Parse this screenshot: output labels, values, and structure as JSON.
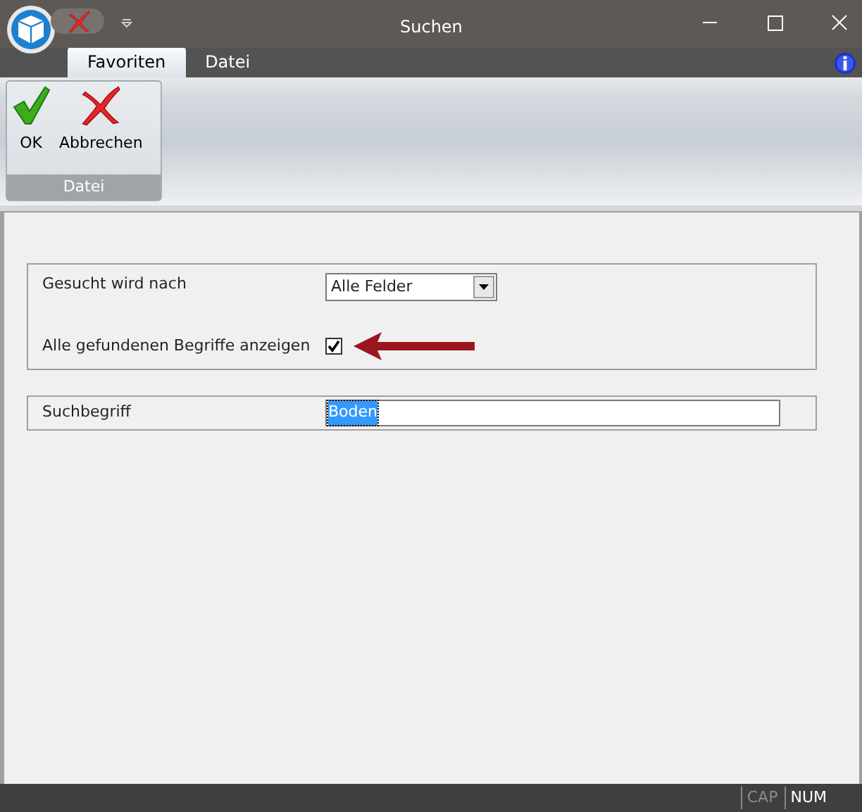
{
  "window": {
    "title": "Suchen"
  },
  "tabs": [
    {
      "label": "Favoriten",
      "selected": true
    },
    {
      "label": "Datei",
      "selected": false
    }
  ],
  "ribbon": {
    "groups": [
      {
        "label": "Datei",
        "buttons": [
          {
            "label": "OK",
            "kind": "check"
          },
          {
            "label": "Abbrechen",
            "kind": "cross"
          }
        ]
      }
    ]
  },
  "form": {
    "groups": [
      {
        "rows": [
          {
            "kind": "dropdown",
            "label": "Gesucht wird nach",
            "value": "Alle Felder"
          },
          {
            "kind": "checkbox",
            "label": "Alle gefundenen Begriffe anzeigen",
            "checked": true,
            "highlighted": true
          }
        ]
      },
      {
        "rows": [
          {
            "kind": "text",
            "label": "Suchbegriff",
            "value": "Boden",
            "value_selected": true
          }
        ]
      }
    ]
  },
  "status_bar": [
    {
      "label": "CAP",
      "on": false
    },
    {
      "label": "NUM",
      "on": true
    }
  ]
}
